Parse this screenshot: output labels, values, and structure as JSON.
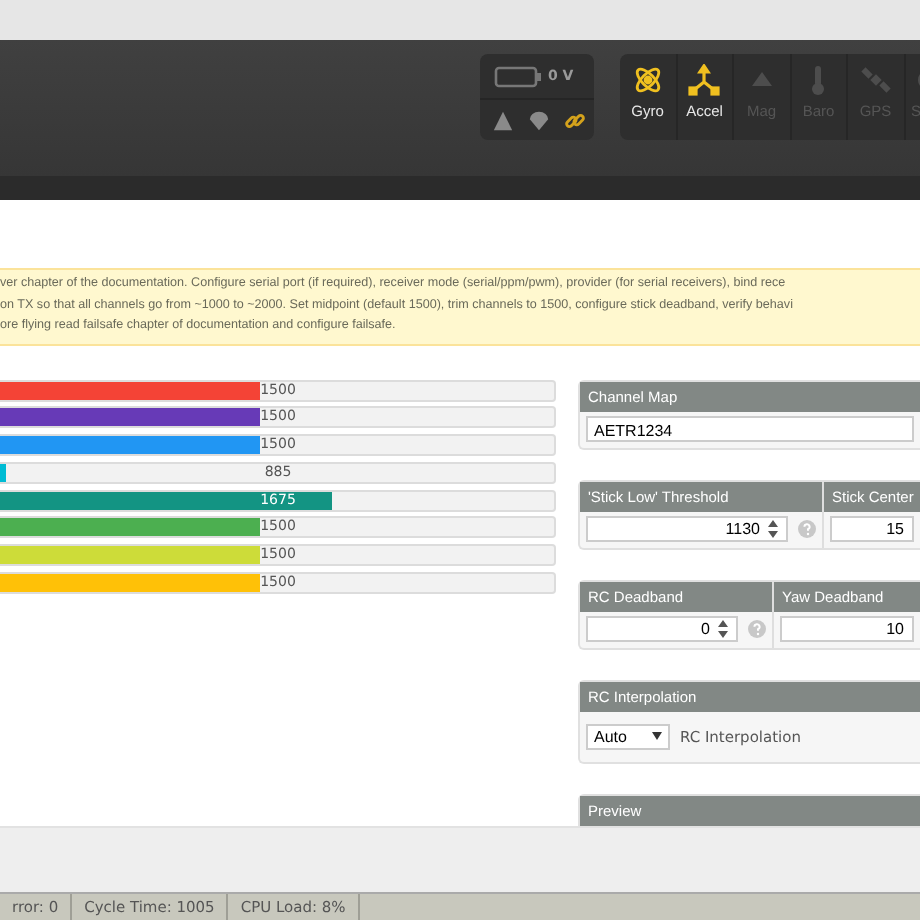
{
  "battery": {
    "voltage": "0 V"
  },
  "status_icons": [
    {
      "kind": "warning",
      "active": false
    },
    {
      "kind": "parachute",
      "active": false
    },
    {
      "kind": "link",
      "active": true
    }
  ],
  "sensors": [
    {
      "kind": "gyro",
      "label": "Gyro",
      "active": true
    },
    {
      "kind": "accel",
      "label": "Accel",
      "active": true
    },
    {
      "kind": "mag",
      "label": "Mag",
      "active": false
    },
    {
      "kind": "baro",
      "label": "Baro",
      "active": false
    },
    {
      "kind": "gps",
      "label": "GPS",
      "active": false
    },
    {
      "kind": "sonar",
      "label": "S",
      "active": false
    }
  ],
  "note": [
    "ver chapter of the documentation. Configure serial port (if required), receiver mode (serial/ppm/pwm), provider (for serial receivers), bind rece",
    "on TX so that all channels go from ~1000 to ~2000. Set midpoint (default 1500), trim channels to 1500, configure stick deadband, verify behavi",
    "ore flying read failsafe chapter of documentation and configure failsafe."
  ],
  "channels": [
    {
      "value": "1500",
      "level": 0.47,
      "color": "#f44336"
    },
    {
      "value": "1500",
      "level": 0.47,
      "color": "#673ab7"
    },
    {
      "value": "1500",
      "level": 0.47,
      "color": "#2196f3"
    },
    {
      "value": "885",
      "level": 0.01,
      "color": "#00bcd4"
    },
    {
      "value": "1675",
      "level": 0.6,
      "color": "#139483"
    },
    {
      "value": "1500",
      "level": 0.47,
      "color": "#4caf50"
    },
    {
      "value": "1500",
      "level": 0.47,
      "color": "#cddc39"
    },
    {
      "value": "1500",
      "level": 0.47,
      "color": "#ffc107"
    }
  ],
  "channel_map": {
    "title": "Channel Map",
    "value": "AETR1234"
  },
  "settings_rows": [
    {
      "fields": [
        {
          "title": "'Stick Low' Threshold",
          "value": "1130",
          "spinner": true,
          "help": true
        },
        {
          "title": "Stick Center",
          "value": "15",
          "spinner": false,
          "help": false
        }
      ]
    },
    {
      "fields": [
        {
          "title": "RC Deadband",
          "value": "0",
          "spinner": true,
          "help": true
        },
        {
          "title": "Yaw Deadband",
          "value": "10",
          "spinner": false,
          "help": false
        }
      ]
    }
  ],
  "rc_interpolation": {
    "title": "RC Interpolation",
    "select": "Auto",
    "label": "RC Interpolation"
  },
  "preview": {
    "title": "Preview"
  },
  "status_bar": [
    "rror: 0",
    "Cycle Time: 1005",
    "CPU Load: 8%"
  ]
}
